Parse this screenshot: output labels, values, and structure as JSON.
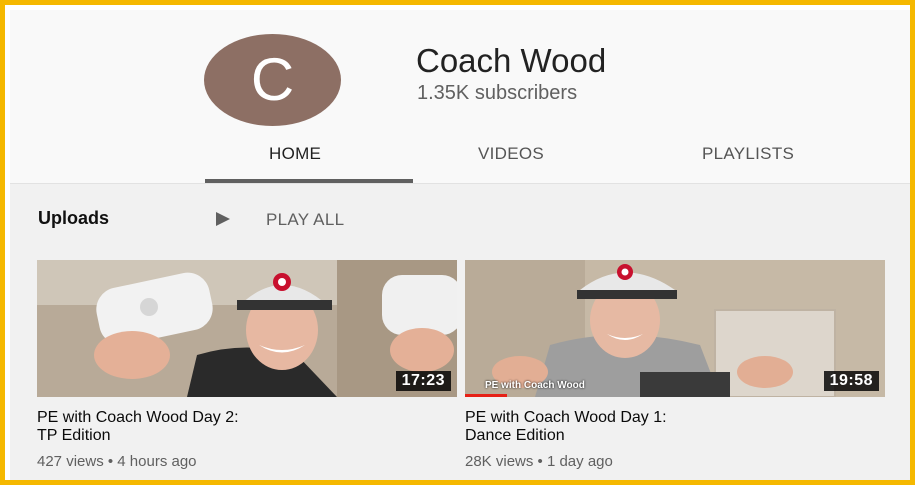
{
  "channel": {
    "avatar_letter": "C",
    "name": "Coach Wood",
    "subscribers": "1.35K subscribers",
    "avatar_color": "#8d6f64"
  },
  "tabs": [
    {
      "label": "HOME",
      "active": true
    },
    {
      "label": "VIDEOS",
      "active": false
    },
    {
      "label": "PLAYLISTS",
      "active": false
    }
  ],
  "uploads": {
    "title": "Uploads",
    "play_icon": "play-icon",
    "play_all_label": "PLAY ALL"
  },
  "videos": [
    {
      "title_line1": "PE with Coach Wood Day 2:",
      "title_line2": "TP Edition",
      "duration": "17:23",
      "meta": "427 views • 4 hours ago",
      "overlay_text": ""
    },
    {
      "title_line1": "PE with Coach Wood Day 1:",
      "title_line2": "Dance Edition",
      "duration": "19:58",
      "meta": "28K views • 1 day ago",
      "overlay_text": "PE with Coach Wood",
      "watch_progress": 0.1
    }
  ],
  "colors": {
    "border": "#f5b800",
    "progress": "#e62117"
  }
}
